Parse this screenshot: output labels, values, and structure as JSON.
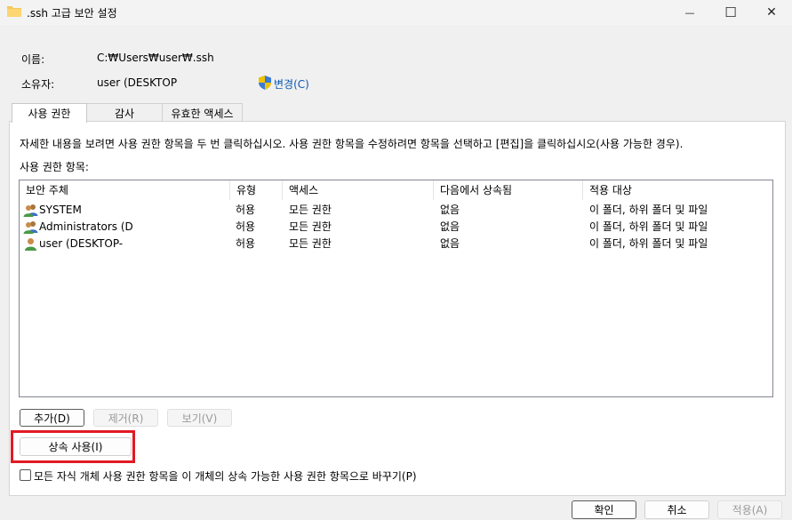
{
  "window": {
    "title": ".ssh 고급 보안 설정",
    "minimize_glyph": "—",
    "maximize_glyph": "☐",
    "close_glyph": "✕"
  },
  "fields": {
    "name_label": "이름:",
    "name_value": "C:₩Users₩user₩.ssh",
    "owner_label": "소유자:",
    "owner_value": "user (DESKTOP",
    "change_link": "변경(C)"
  },
  "tabs": [
    {
      "label": "사용 권한",
      "active": true
    },
    {
      "label": "감사",
      "active": false
    },
    {
      "label": "유효한 액세스",
      "active": false
    }
  ],
  "instructions": "자세한 내용을 보려면 사용 권한 항목을 두 번 클릭하십시오. 사용 권한 항목을 수정하려면 항목을 선택하고 [편집]을 클릭하십시오(사용 가능한 경우).",
  "entries_label": "사용 권한 항목:",
  "table": {
    "headers": [
      "보안 주체",
      "유형",
      "액세스",
      "다음에서 상속됨",
      "적용 대상"
    ],
    "rows": [
      {
        "principal": "SYSTEM",
        "type": "허용",
        "access": "모든 권한",
        "inherited": "없음",
        "applies": "이 폴더, 하위 폴더 및 파일",
        "icon": "group-users-icon"
      },
      {
        "principal": "Administrators (D",
        "type": "허용",
        "access": "모든 권한",
        "inherited": "없음",
        "applies": "이 폴더, 하위 폴더 및 파일",
        "icon": "group-users-icon"
      },
      {
        "principal": "user (DESKTOP-",
        "type": "허용",
        "access": "모든 권한",
        "inherited": "없음",
        "applies": "이 폴더, 하위 폴더 및 파일",
        "icon": "single-user-icon"
      }
    ]
  },
  "buttons": {
    "add": "추가(D)",
    "remove": "제거(R)",
    "view": "보기(V)",
    "enable_inheritance": "상속 사용(I)",
    "ok": "확인",
    "cancel": "취소",
    "apply": "적용(A)"
  },
  "replace_checkbox_label": "모든 자식 개체 사용 권한 항목을 이 개체의 상속 가능한 사용 권한 항목으로 바꾸기(P)",
  "colors": {
    "highlight": "#e01b24",
    "link": "#0a58b0"
  }
}
